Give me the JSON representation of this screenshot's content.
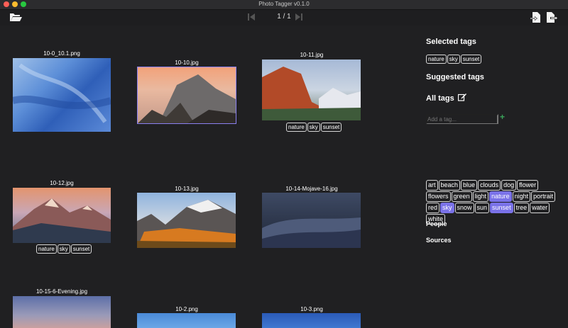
{
  "window": {
    "title": "Photo Tagger v0.1.0"
  },
  "toolbar": {
    "page_indicator": "1 / 1"
  },
  "colors": {
    "accent": "#7a72e8",
    "add": "#3aa45a"
  },
  "icons": {
    "open": "folder-open-icon",
    "first": "skip-first-icon",
    "last": "skip-last-icon",
    "import": "import-file-icon",
    "export": "export-icon",
    "edit": "edit-icon"
  },
  "photos": [
    {
      "filename": "10-0_10.1.png",
      "tags": []
    },
    {
      "filename": "10-10.jpg",
      "tags": []
    },
    {
      "filename": "10-11.jpg",
      "tags": [
        "nature",
        "sky",
        "sunset"
      ]
    },
    {
      "filename": "10-12.jpg",
      "tags": [
        "nature",
        "sky",
        "sunset"
      ]
    },
    {
      "filename": "10-13.jpg",
      "tags": []
    },
    {
      "filename": "10-14-Mojave-16.jpg",
      "tags": []
    },
    {
      "filename": "10-15-6-Evening.jpg",
      "tags": []
    },
    {
      "filename": "10-2.png",
      "tags": []
    },
    {
      "filename": "10-3.png",
      "tags": []
    }
  ],
  "sidebar": {
    "selected_heading": "Selected tags",
    "selected_tags": [
      "nature",
      "sky",
      "sunset"
    ],
    "suggested_heading": "Suggested tags",
    "all_heading": "All tags",
    "add_placeholder": "Add a tag...",
    "add_symbol": "+",
    "all_tags": [
      {
        "label": "art",
        "on": false
      },
      {
        "label": "beach",
        "on": false
      },
      {
        "label": "blue",
        "on": false
      },
      {
        "label": "clouds",
        "on": false
      },
      {
        "label": "dog",
        "on": false
      },
      {
        "label": "flower",
        "on": false
      },
      {
        "label": "flowers",
        "on": false
      },
      {
        "label": "green",
        "on": false
      },
      {
        "label": "light",
        "on": false
      },
      {
        "label": "nature",
        "on": true
      },
      {
        "label": "night",
        "on": false
      },
      {
        "label": "portrait",
        "on": false
      },
      {
        "label": "red",
        "on": false
      },
      {
        "label": "sky",
        "on": true
      },
      {
        "label": "snow",
        "on": false
      },
      {
        "label": "sun",
        "on": false
      },
      {
        "label": "sunset",
        "on": true
      },
      {
        "label": "tree",
        "on": false
      },
      {
        "label": "water",
        "on": false
      },
      {
        "label": "white",
        "on": false
      }
    ],
    "people_heading": "People",
    "sources_heading": "Sources"
  }
}
